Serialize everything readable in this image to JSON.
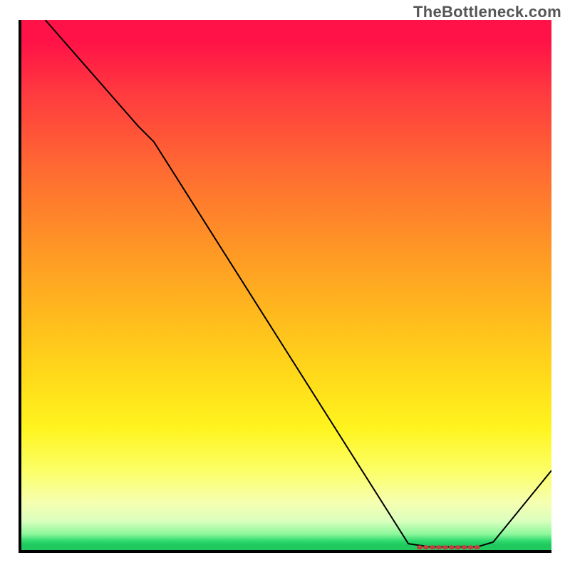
{
  "watermark": "TheBottleneck.com",
  "chart_data": {
    "type": "line",
    "title": "",
    "xlabel": "",
    "ylabel": "",
    "xlim": [
      0,
      100
    ],
    "ylim": [
      0,
      100
    ],
    "background": "performance-gradient",
    "note": "Axes and ticks are not labeled in the source image; x and y are expressed as percentages of the plot area.",
    "series": [
      {
        "name": "curve",
        "points": [
          {
            "x": 4.5,
            "y": 100.0
          },
          {
            "x": 22.0,
            "y": 80.0
          },
          {
            "x": 25.0,
            "y": 77.0
          },
          {
            "x": 73.0,
            "y": 1.2
          },
          {
            "x": 77.0,
            "y": 0.6
          },
          {
            "x": 86.0,
            "y": 0.6
          },
          {
            "x": 89.0,
            "y": 1.5
          },
          {
            "x": 100.0,
            "y": 15.0
          }
        ]
      }
    ],
    "annotations": [
      {
        "name": "optimal-range-marker",
        "style": "dotted-red",
        "y": 0.5,
        "x_start": 75.0,
        "x_end": 87.0
      }
    ]
  }
}
